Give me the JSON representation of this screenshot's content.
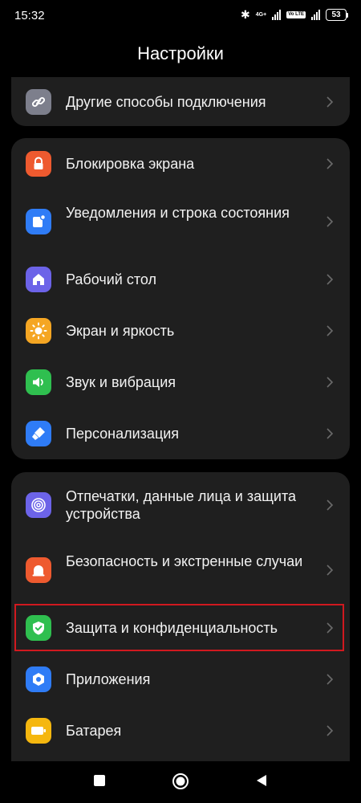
{
  "status_bar": {
    "time": "15:32",
    "network": "4G+",
    "volte": "Vo LTE",
    "battery": "53"
  },
  "title": "Настройки",
  "colors": {
    "background": "#000000",
    "card": "#1f1f1f",
    "highlight": "#d0191f"
  },
  "groups": [
    {
      "items": [
        {
          "label": "Другие способы подключения",
          "icon": "link-icon",
          "color": "#7d7f8c"
        }
      ]
    },
    {
      "items": [
        {
          "label": "Блокировка экрана",
          "icon": "lock-icon",
          "color": "#ee5a2f"
        },
        {
          "label": "Уведомления и строка состояния",
          "icon": "notification-icon",
          "color": "#2f7cf6"
        },
        {
          "label": "Рабочий стол",
          "icon": "home-icon",
          "color": "#6c63e8"
        },
        {
          "label": "Экран и яркость",
          "icon": "sun-icon",
          "color": "#f5a623"
        },
        {
          "label": "Звук и вибрация",
          "icon": "speaker-icon",
          "color": "#2fbf4f"
        },
        {
          "label": "Персонализация",
          "icon": "brush-icon",
          "color": "#2f7cf6"
        }
      ]
    },
    {
      "items": [
        {
          "label": "Отпечатки, данные лица и защита устройства",
          "icon": "fingerprint-icon",
          "color": "#6c63e8"
        },
        {
          "label": "Безопасность и экстренные случаи",
          "icon": "emergency-icon",
          "color": "#ee5a2f"
        },
        {
          "label": "Защита и конфиденциальность",
          "icon": "shield-check-icon",
          "color": "#2fbf4f",
          "highlighted": true
        },
        {
          "label": "Приложения",
          "icon": "apps-icon",
          "color": "#2f7cf6"
        },
        {
          "label": "Батарея",
          "icon": "battery-icon",
          "color": "#f5b70f"
        }
      ]
    }
  ]
}
